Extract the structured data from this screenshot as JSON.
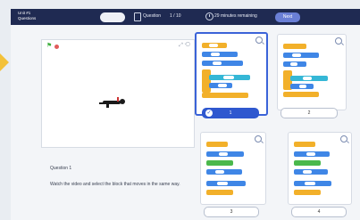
{
  "header": {
    "title_line1": "Unit #1",
    "title_line2": "Questions",
    "question_label": "Question",
    "question_count": "1 / 10",
    "minutes_text": "29 minutes remaining",
    "next_label": "Next"
  },
  "stage": {
    "stage_tools": "⤢ ⟲"
  },
  "question": {
    "number": "Question 1",
    "prompt": "Watch the video and select the block that moves in the same way."
  },
  "options": [
    {
      "label": "1",
      "selected": true
    },
    {
      "label": "2",
      "selected": false
    },
    {
      "label": "3",
      "selected": false
    },
    {
      "label": "4",
      "selected": false
    }
  ],
  "colors": {
    "topbar": "#1f2a52",
    "select_accent": "#2f58cf",
    "block_yellow": "#f2b02a",
    "block_blue": "#3f86e6",
    "block_cyan": "#35b7d6",
    "block_green": "#4ab84c"
  }
}
